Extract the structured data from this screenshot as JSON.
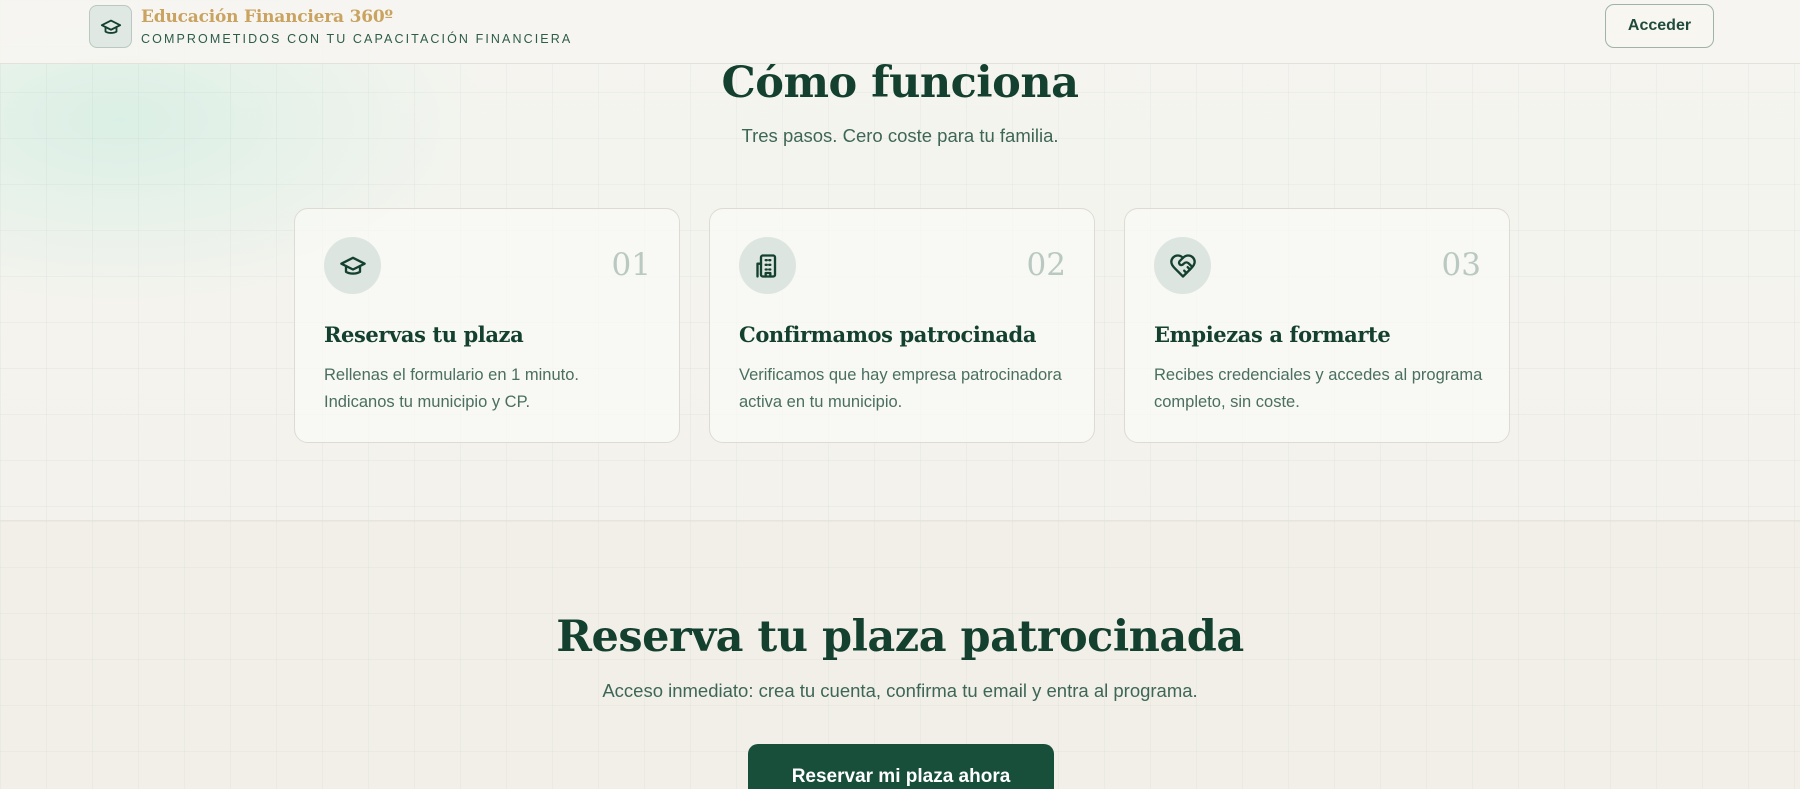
{
  "header": {
    "brand_title": "Educación Financiera 360º",
    "brand_subtitle": "COMPROMETIDOS CON TU CAPACITACIÓN FINANCIERA",
    "login_label": "Acceder",
    "logo_icon": "graduation-cap-icon"
  },
  "how_it_works": {
    "title": "Cómo funciona",
    "subtitle": "Tres pasos. Cero coste para tu familia.",
    "steps": [
      {
        "number": "01",
        "icon": "graduation-cap-icon",
        "title": "Reservas tu plaza",
        "text": "Rellenas el formulario en 1 minuto. Indicanos tu municipio y CP."
      },
      {
        "number": "02",
        "icon": "building-icon",
        "title": "Confirmamos patrocinada",
        "text": "Verificamos que hay empresa patrocinadora activa en tu municipio."
      },
      {
        "number": "03",
        "icon": "heart-handshake-icon",
        "title": "Empiezas a formarte",
        "text": "Recibes credenciales y accedes al programa completo, sin coste."
      }
    ]
  },
  "reserve": {
    "title": "Reserva tu plaza patrocinada",
    "subtitle": "Acceso inmediato: crea tu cuenta, confirma tu email y entra al programa.",
    "cta_label": "Reservar mi plaza ahora"
  },
  "colors": {
    "primary": "#174f3b",
    "gold": "#c9a35f",
    "background": "#f4f2ec"
  }
}
